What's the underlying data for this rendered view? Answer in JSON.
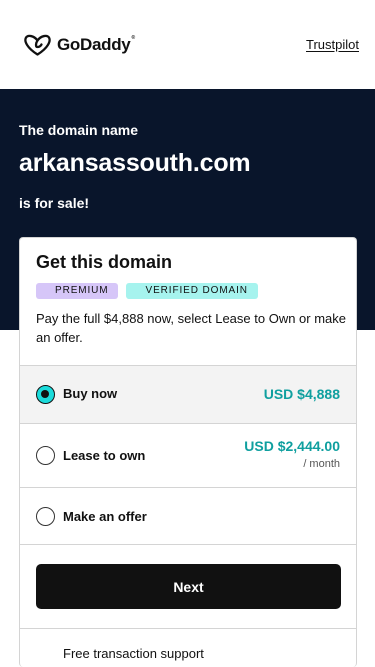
{
  "header": {
    "logo_text": "GoDaddy",
    "logo_tm": "®",
    "trustpilot_link": "Trustpilot"
  },
  "hero": {
    "label": "The domain name",
    "domain": "arkansassouth.com",
    "sale_text": "is for sale!"
  },
  "card": {
    "title": "Get this domain",
    "badges": [
      "PREMIUM",
      "VERIFIED DOMAIN"
    ],
    "description": "Pay the full $4,888 now, select Lease to Own or make an offer.",
    "options": [
      {
        "label": "Buy now",
        "price": "USD $4,888",
        "selected": true
      },
      {
        "label": "Lease to own",
        "price": "USD $2,444.00",
        "sub": "/ month",
        "selected": false
      },
      {
        "label": "Make an offer",
        "selected": false
      }
    ],
    "next_button": "Next",
    "support_text": "Free transaction support"
  },
  "colors": {
    "hero_bg": "#09152b",
    "accent_teal": "#0f9f9f",
    "radio_selected": "#1bdbdb",
    "badge_premium": "#d6c6f8",
    "badge_verified": "#a6f3ee",
    "button_bg": "#111111"
  },
  "icons": {
    "logo": "godaddy-logo-icon",
    "radio": "radio-button-icon"
  }
}
